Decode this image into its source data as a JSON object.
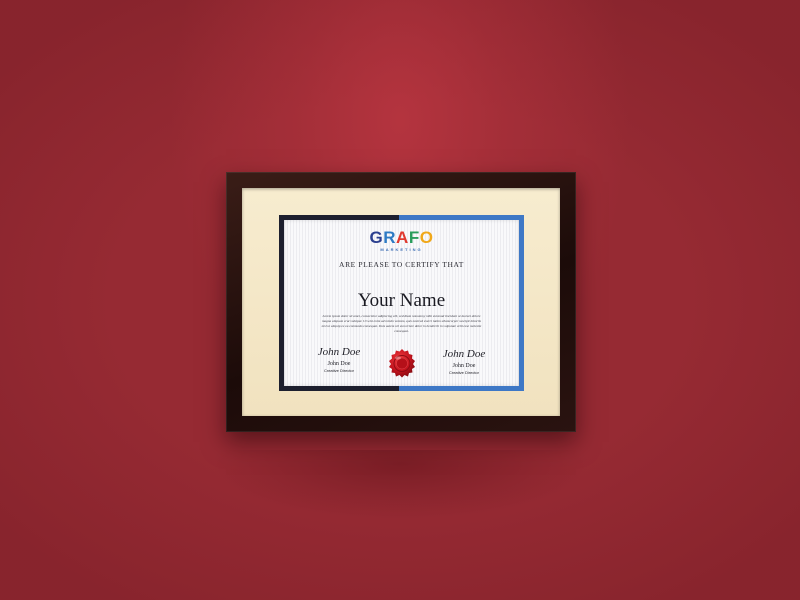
{
  "scene": {
    "colors": {
      "wall": "#962a33",
      "frame": "#1c0b09",
      "mat": "#f4e6c6",
      "border_dark": "#1d1f2e",
      "border_blue": "#3e78c6",
      "seal": "#c4141e"
    }
  },
  "certificate": {
    "logo": {
      "text": "GRAFO",
      "subtitle": "MARKETING"
    },
    "certify_line": "ARE PLEASE TO CERTIFY THAT",
    "recipient": "Your Name",
    "body": "Lorem ipsum dolor sit amet, consectetur adipiscing elit, sed diam nonummy nibh euismod tincidunt ut laoreet dolore magna aliquam erat volutpat. Ut wisi enim ad minim veniam, quis nostrud exerci tation ullamcorper suscipit lobortis nisl ut aliquip ex ea commodo consequat. Duis autem vel eum iriure dolor in hendrerit in vulputate velit esse molestie consequat.",
    "signatures": [
      {
        "signature": "John Doe",
        "name": "John Doe",
        "title": "Creative Director"
      },
      {
        "signature": "John Doe",
        "name": "John Doe",
        "title": "Creative Director"
      }
    ],
    "seal_icon": "wax-seal-icon"
  }
}
